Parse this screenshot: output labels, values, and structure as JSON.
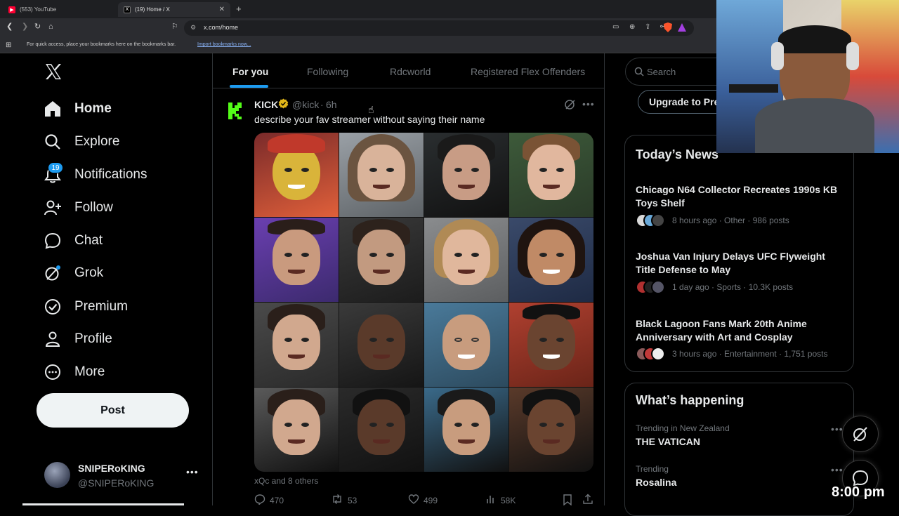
{
  "browser": {
    "tabs": [
      {
        "label": "(553) YouTube",
        "favicon_color": "#ff0033"
      },
      {
        "label": "(19) Home / X",
        "favicon_color": "#000000"
      }
    ],
    "url": "x.com/home",
    "bookmarks_hint": "For quick access, place your bookmarks here on the bookmarks bar.",
    "bookmarks_link": "Import bookmarks now..."
  },
  "sidebar": {
    "items": [
      {
        "label": "Home",
        "icon": "home-icon"
      },
      {
        "label": "Explore",
        "icon": "search-icon"
      },
      {
        "label": "Notifications",
        "icon": "bell-icon",
        "badge": "19"
      },
      {
        "label": "Follow",
        "icon": "add-person-icon"
      },
      {
        "label": "Chat",
        "icon": "chat-bubble-icon"
      },
      {
        "label": "Grok",
        "icon": "grok-icon"
      },
      {
        "label": "Premium",
        "icon": "verified-badge-icon"
      },
      {
        "label": "Profile",
        "icon": "person-icon"
      },
      {
        "label": "More",
        "icon": "more-circle-icon"
      }
    ],
    "post_label": "Post",
    "account": {
      "name": "SNIPERoKING",
      "handle": "@SNIPERoKING"
    }
  },
  "feed": {
    "tabs": [
      "For you",
      "Following",
      "Rdcworld",
      "Registered Flex Offenders"
    ],
    "active_tab": 0,
    "post": {
      "author": "KICK",
      "handle": "@kick",
      "time": "6h",
      "text": "describe your fav streamer without saying their name",
      "tagged": "xQc and 8 others",
      "stats": {
        "replies": "470",
        "reposts": "53",
        "likes": "499",
        "views": "58K"
      }
    }
  },
  "right": {
    "search_placeholder": "Search",
    "upgrade_label": "Upgrade to Pre",
    "news_title": "Today’s News",
    "news": [
      {
        "title": "Chicago N64 Collector Recreates 1990s KB Toys Shelf",
        "meta": "8 hours ago · Other · 986 posts"
      },
      {
        "title": "Joshua Van Injury Delays UFC Flyweight Title Defense to May",
        "meta": "1 day ago · Sports · 10.3K posts"
      },
      {
        "title": "Black Lagoon Fans Mark 20th Anime Anniversary with Art and Cosplay",
        "meta": "3 hours ago · Entertainment · 1,751 posts"
      }
    ],
    "happening_title": "What’s happening",
    "trends": [
      {
        "sub": "Trending in New Zealand",
        "main": "THE VATICAN"
      },
      {
        "sub": "Trending",
        "main": "Rosalina"
      }
    ]
  },
  "overlay": {
    "clock": "8:00 pm"
  },
  "colors": {
    "accent": "#1d9bf0",
    "kick_green": "#53fc18",
    "verified_gold": "#e2b719"
  }
}
